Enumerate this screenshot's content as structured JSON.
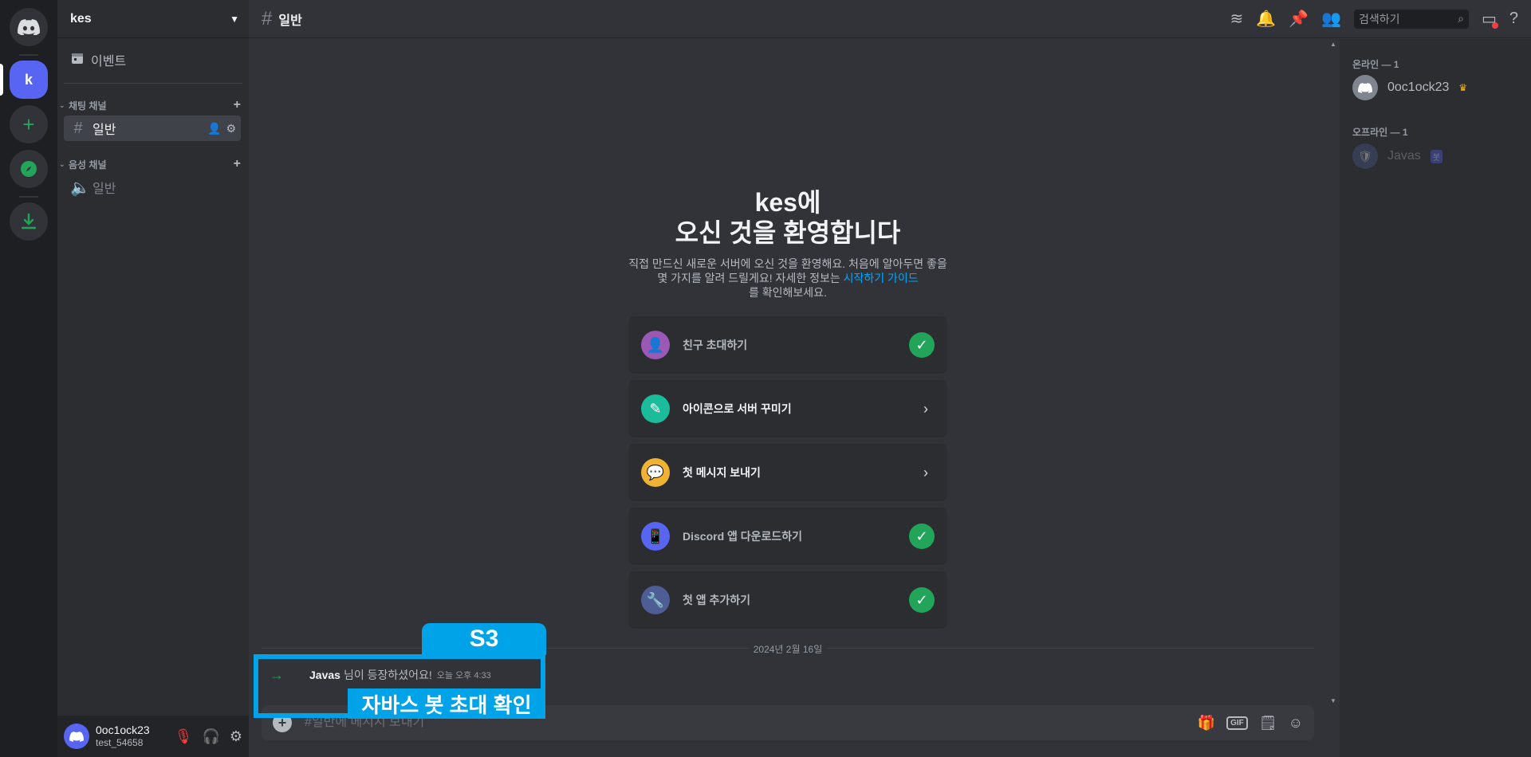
{
  "server": {
    "name": "kes",
    "rail_initial": "k"
  },
  "sidebar": {
    "events_label": "이벤트",
    "categories": [
      {
        "name": "채팅 채널",
        "channels": [
          {
            "name": "일반",
            "type": "text",
            "active": true
          }
        ]
      },
      {
        "name": "음성 채널",
        "channels": [
          {
            "name": "일반",
            "type": "voice",
            "active": false
          }
        ]
      }
    ]
  },
  "user": {
    "name": "0oc1ock23",
    "tag": "test_54658"
  },
  "topbar": {
    "channel_name": "일반",
    "search_placeholder": "검색하기"
  },
  "welcome": {
    "title_server": "kes에",
    "title_rest": "오신 것을 환영합니다",
    "desc_part1": "직접 만드신 새로운 서버에 오신 것을 환영해요. 처음에 알아두면 좋을 몇 가지를 알려    드릴게요! 자세한 정보는 ",
    "desc_link": "시작하기 가이드",
    "desc_part2": "를 확인해보세요."
  },
  "cards": [
    {
      "label": "친구 초대하기",
      "done": true,
      "icon": "invite-icon",
      "color": "#9b59b6"
    },
    {
      "label": "아이콘으로 서버 꾸미기",
      "done": false,
      "icon": "brush-icon",
      "color": "#1abc9c"
    },
    {
      "label": "첫 메시지 보내기",
      "done": false,
      "icon": "message-icon",
      "color": "#f0b232"
    },
    {
      "label": "Discord 앱 다운로드하기",
      "done": true,
      "icon": "phone-icon",
      "color": "#5865f2"
    },
    {
      "label": "첫 앱 추가하기",
      "done": true,
      "icon": "robot-icon",
      "color": "#4e5d94"
    }
  ],
  "date_divider": "2024년 2월 16일",
  "join_message": {
    "name": "Javas",
    "text": "님이 등장하셨어요!",
    "time": "오늘 오후 4:33"
  },
  "composer": {
    "placeholder": "#일반에 메시지 보내기",
    "gif_label": "GIF"
  },
  "members": {
    "online_header": "온라인 — 1",
    "offline_header": "오프라인 — 1",
    "online": [
      {
        "name": "0oc1ock23",
        "owner": true
      }
    ],
    "offline": [
      {
        "name": "Javas",
        "badge": "봇"
      }
    ]
  },
  "overlay": {
    "step": "S3",
    "caption": "자바스 봇 초대 확인"
  },
  "colors": {
    "accent": "#5865f2",
    "success": "#23a559",
    "overlay": "#00a2e8"
  }
}
